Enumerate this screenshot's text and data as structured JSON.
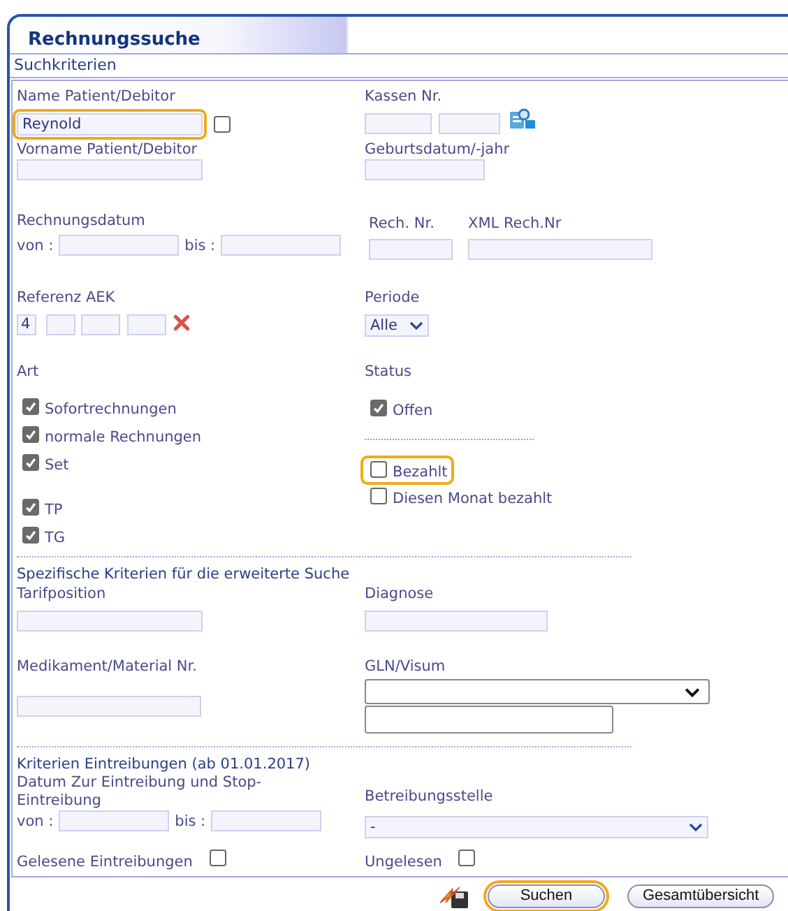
{
  "window": {
    "title": "Rechnungssuche"
  },
  "section": "Suchkriterien",
  "name": {
    "label": "Name Patient/Debitor",
    "value": "Reynold",
    "highlighted": true,
    "checked": false
  },
  "kassen": {
    "label": "Kassen Nr."
  },
  "vorname": {
    "label": "Vorname Patient/Debitor"
  },
  "geburtsdatum": {
    "label": "Geburtsdatum/-jahr"
  },
  "rechnungsdatum": {
    "label": "Rechnungsdatum",
    "from_label": "von :",
    "to_label": "bis :"
  },
  "rech_nr": {
    "label": "Rech. Nr."
  },
  "xml_rech_nr": {
    "label": "XML Rech.Nr"
  },
  "referenz_aek": {
    "label": "Referenz AEK",
    "value": "4"
  },
  "periode": {
    "label": "Periode",
    "value": "Alle"
  },
  "art": {
    "label": "Art",
    "groups": [
      {
        "options": [
          {
            "label": "Sofortrechnungen",
            "checked": true
          },
          {
            "label": "normale Rechnungen",
            "checked": true
          },
          {
            "label": "Set",
            "checked": true
          }
        ]
      },
      {
        "options": [
          {
            "label": "TP",
            "checked": true
          },
          {
            "label": "TG",
            "checked": true
          }
        ]
      }
    ]
  },
  "status": {
    "label": "Status",
    "groups": [
      {
        "options": [
          {
            "label": "Offen",
            "checked": true,
            "highlighted": false
          }
        ]
      },
      {
        "options": [
          {
            "label": "Bezahlt",
            "checked": false,
            "highlighted": true
          },
          {
            "label": "Diesen Monat bezahlt",
            "checked": false,
            "highlighted": false
          }
        ]
      }
    ]
  },
  "extended": {
    "heading": "Spezifische Kriterien für die erweiterte Suche",
    "tarifposition": {
      "label": "Tarifposition"
    },
    "diagnose": {
      "label": "Diagnose"
    },
    "medikament": {
      "label": "Medikament/Material Nr."
    },
    "gln": {
      "label": "GLN/Visum"
    }
  },
  "collection": {
    "heading": "Kriterien Eintreibungen (ab 01.01.2017)",
    "date_label": "Datum Zur Eintreibung und Stop-Eintreibung",
    "from_label": "von :",
    "to_label": "bis :",
    "office": {
      "label": "Betreibungsstelle",
      "value": "-"
    },
    "read": {
      "label": "Gelesene Eintreibungen",
      "checked": false
    },
    "unread": {
      "label": "Ungelesen",
      "checked": false
    }
  },
  "buttons": [
    {
      "label": "Suchen",
      "highlighted": true
    },
    {
      "label": "Gesamtübersicht",
      "highlighted": false
    }
  ]
}
